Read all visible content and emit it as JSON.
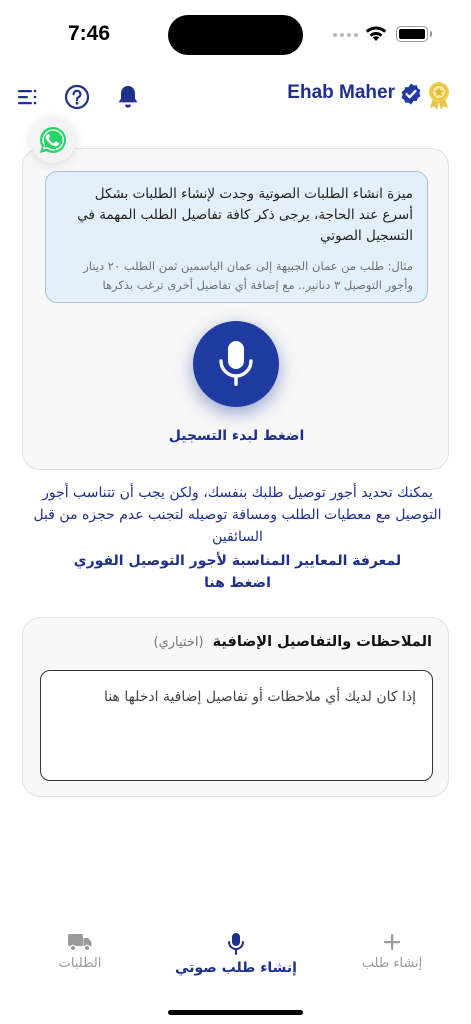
{
  "status": {
    "time": "7:46"
  },
  "header": {
    "user_name": "Ehab Maher"
  },
  "voice": {
    "info_main": "ميزة انشاء الطلبات الصوتية وجدت لإنشاء الطلبات بشكل أسرع عند الحاجة، يرجى ذكر كافة تفاصيل الطلب المهمة في التسجيل الصوتي",
    "info_example": "مثال: طلب من عمان الجبيهة إلى عمان الياسمين ثمن الطلب ٢٠ دينار وأجور التوصيل ٣ دنانير.. مع إضافة أي تفاصيل أخرى ترغب بذكرها",
    "record_label": "اضغط لبدء التسجيل"
  },
  "fee_text": "يمكنك تحديد أجور توصيل طلبك بنفسك، ولكن يجب أن تتناسب أجور التوصيل مع معطيات الطلب ومسافة توصيله لتجنب عدم حجزه من قبل السائقين",
  "criteria_link": {
    "line1": "لمعرفة المعايير المناسبة لأجور التوصيل الفوري",
    "line2": "اضغط هنا"
  },
  "notes": {
    "title": "الملاحظات والتفاصيل الإضافية",
    "optional": "(اختياري)",
    "placeholder": "إذا كان لديك أي ملاحظات أو تفاصيل إضافية ادخلها هنا",
    "value": ""
  },
  "nav": {
    "orders": "الطلبات",
    "voice_order": "إنشاء طلب صوتي",
    "create_order": "إنشاء طلب"
  },
  "colors": {
    "brand": "#1f2f8c",
    "accent": "#1f3aa0",
    "info_bg": "#e4effc",
    "whatsapp": "#25d366"
  }
}
